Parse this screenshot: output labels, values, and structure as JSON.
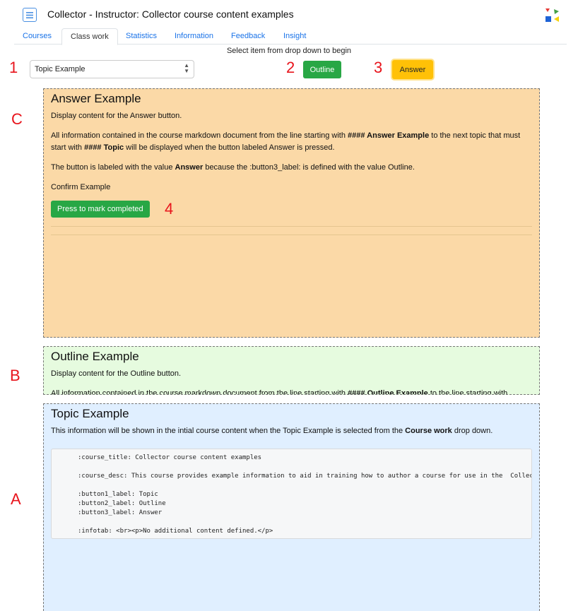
{
  "header": {
    "title": "Collector - Instructor: Collector course content examples"
  },
  "tabs": [
    {
      "label": "Courses",
      "active": false
    },
    {
      "label": "Class work",
      "active": true
    },
    {
      "label": "Statistics",
      "active": false
    },
    {
      "label": "Information",
      "active": false
    },
    {
      "label": "Feedback",
      "active": false
    },
    {
      "label": "Insight",
      "active": false
    }
  ],
  "hint": "Select item from drop down to begin",
  "markers": {
    "m1": "1",
    "m2": "2",
    "m3": "3",
    "m4": "4",
    "mA": "A",
    "mB": "B",
    "mC": "C"
  },
  "controls": {
    "select_value": "Topic Example",
    "outline_label": "Outline",
    "answer_label": "Answer"
  },
  "answer_panel": {
    "title": "Answer Example",
    "p1": "Display content for the Answer button.",
    "p2": [
      "All information contained in the course markdown document from the line starting with ",
      "#### Answer Example",
      " to the next topic that must start with ",
      "#### Topic",
      " will be displayed when the button labeled Answer is pressed."
    ],
    "p3": [
      "The button is labeled with the value ",
      "Answer",
      " because the :button3_label: is defined with the value Outline."
    ],
    "p4": "Confirm Example",
    "complete_label": "Press to mark completed"
  },
  "outline_panel": {
    "title": "Outline Example",
    "p1": "Display content for the Outline button.",
    "p2": [
      "All information contained in the course markdown document from the line starting with ",
      "#### Outline Example",
      " to the line starting with"
    ]
  },
  "topic_panel": {
    "title": "Topic Example",
    "p1": [
      "This information will be shown in the intial course content when the Topic Example is selected from the ",
      "Course work",
      " drop down."
    ],
    "code": [
      ":course_title: Collector course content examples",
      "",
      ":course_desc: This course provides example information to aid in training how to author a course for use in the  Collector",
      "",
      ":button1_label: Topic",
      ":button2_label: Outline",
      ":button3_label: Answer",
      "",
      ":infotab: <br><p>No additional content defined.</p>"
    ]
  },
  "colors": {
    "answer_bg": "#fbd9a7",
    "outline_bg": "#e6fbdf",
    "topic_bg": "#e0efff",
    "green": "#28a745",
    "yellow": "#ffc107",
    "marker": "#e8141c",
    "link": "#1a73e8"
  }
}
